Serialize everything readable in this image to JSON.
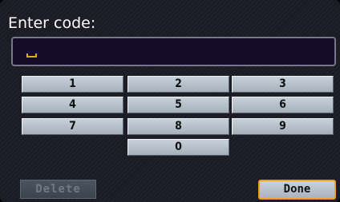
{
  "prompt": {
    "title": "Enter code:"
  },
  "code_field": {
    "value": "",
    "cursor_color": "#e8a81c"
  },
  "keypad": {
    "keys": [
      "1",
      "2",
      "3",
      "4",
      "5",
      "6",
      "7",
      "8",
      "9",
      "0"
    ]
  },
  "actions": {
    "delete_label": "Delete",
    "delete_enabled": false,
    "done_label": "Done",
    "done_highlight_color": "#f0a018"
  }
}
